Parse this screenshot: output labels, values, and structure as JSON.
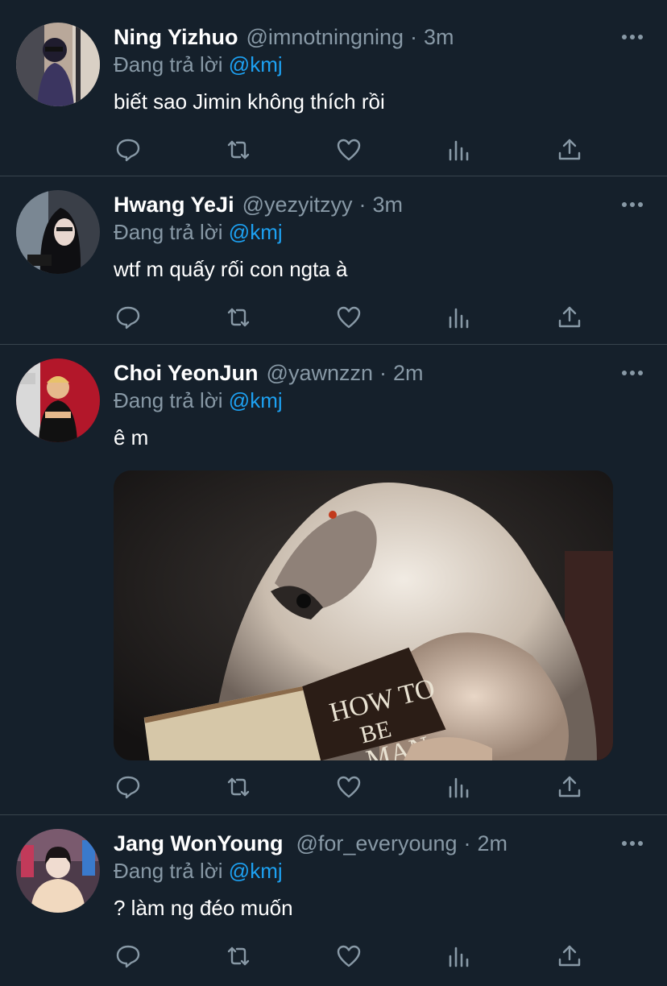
{
  "tweets": [
    {
      "name": "Ning Yizhuo",
      "handle": "@imnotningning",
      "separator": "·",
      "time": "3m",
      "replying_prefix": "Đang trả lời",
      "replying_to": "@kmj",
      "text": "biết sao Jimin không thích rồi"
    },
    {
      "name": "Hwang YeJi",
      "handle": "@yezyitzyy",
      "separator": "·",
      "time": "3m",
      "replying_prefix": "Đang trả lời",
      "replying_to": "@kmj",
      "text": "wtf m quấy rối con ngta à"
    },
    {
      "name": "Choi YeonJun",
      "handle": "@yawnzzn",
      "separator": "·",
      "time": "2m",
      "replying_prefix": "Đang trả lời",
      "replying_to": "@kmj",
      "text": "ê m",
      "media": {
        "book_title_line1": "HOW TO",
        "book_title_line2": "BE",
        "book_title_line3": "MAN"
      }
    },
    {
      "name": "Jang WonYoung",
      "handle": "@for_everyoung",
      "separator": "·",
      "time": "2m",
      "replying_prefix": "Đang trả lời",
      "replying_to": "@kmj",
      "text": "? làm ng đéo muốn"
    }
  ],
  "icons": [
    "reply-icon",
    "retweet-icon",
    "like-icon",
    "analytics-icon",
    "share-icon",
    "more-icon"
  ],
  "colors": {
    "background": "#15202b",
    "text": "#ffffff",
    "muted": "#8899a6",
    "accent": "#1da1f2",
    "divider": "#38444d"
  }
}
